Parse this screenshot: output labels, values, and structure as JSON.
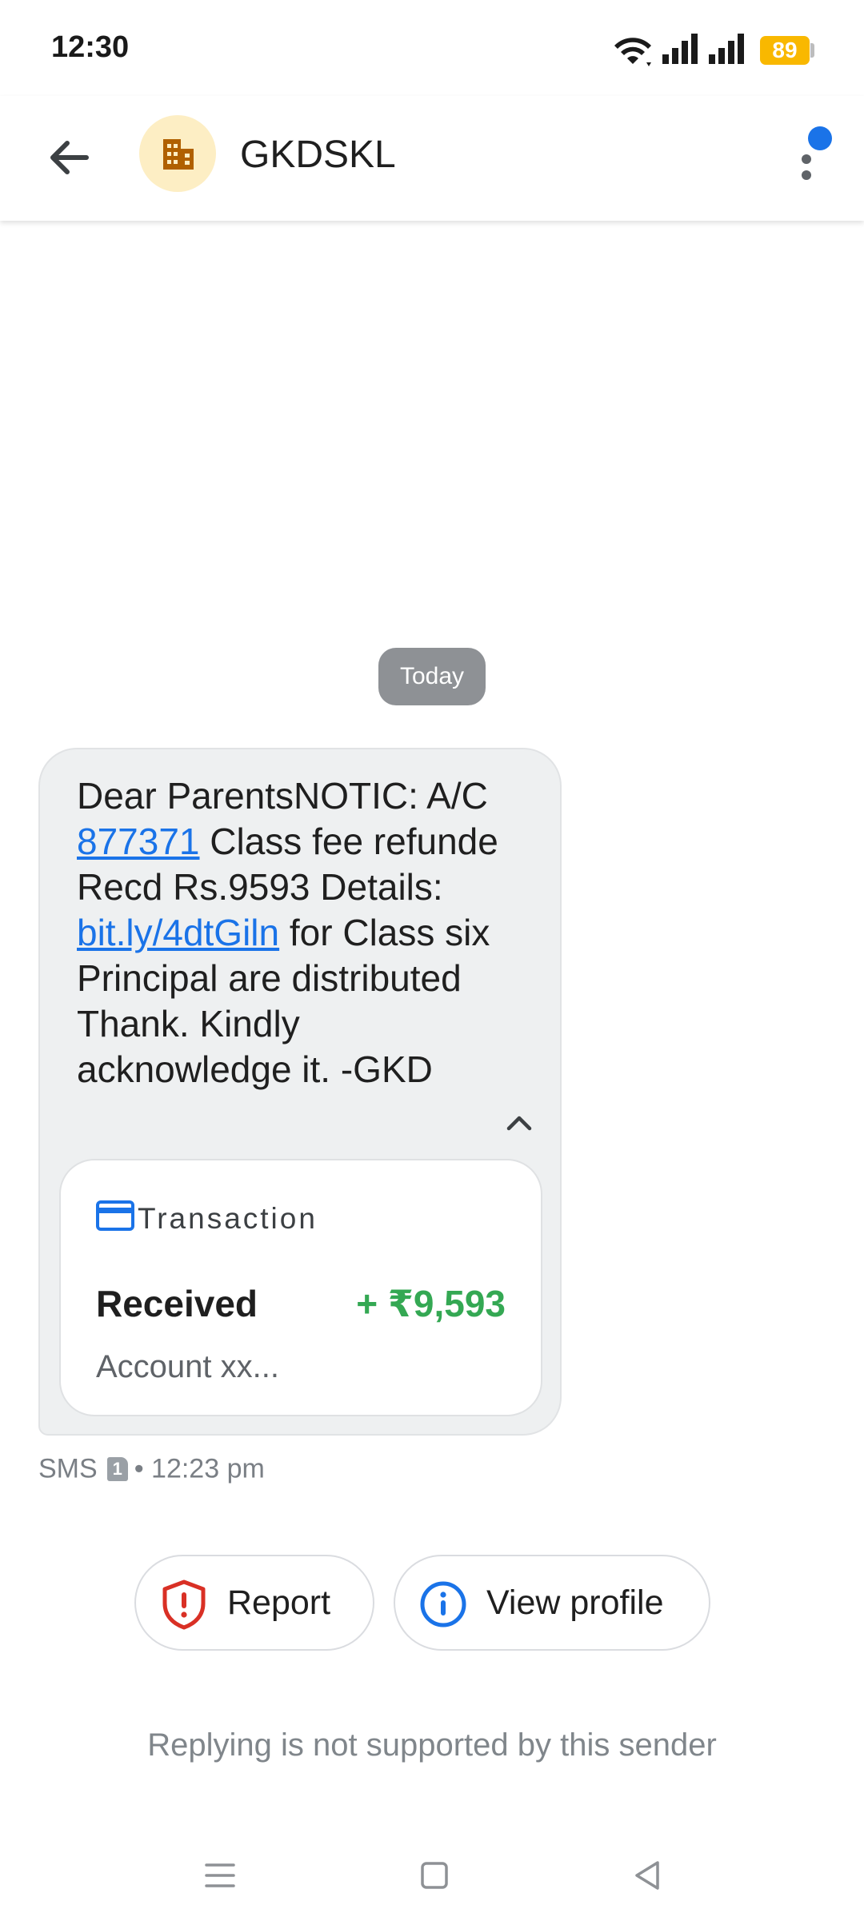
{
  "status_bar": {
    "time": "12:30",
    "battery": "89",
    "battery_color": "#f9b800"
  },
  "header": {
    "title": "GKDSKL",
    "avatar_icon": "business-icon",
    "avatar_bg": "#fdeec4",
    "has_notification_dot": true,
    "accent": "#1a73e8"
  },
  "conversation": {
    "date_label": "Today",
    "message": {
      "text_parts": [
        "Dear ParentsNOTIC: A/C ",
        "877371",
        " Class fee refunde Recd Rs.9593 Details: ",
        "bit.ly/4dtGiln",
        " for Class six Principal are distributed Thank. Kindly acknowledge it. -GKD"
      ],
      "links": [
        "877371",
        "bit.ly/4dtGiln"
      ]
    },
    "card": {
      "label": "Transaction",
      "status": "Received",
      "amount": "+ ₹9,593",
      "amount_color": "#34a853",
      "account": "Account xx..."
    },
    "meta": {
      "channel": "SMS",
      "sim": "1",
      "time": "• 12:23 pm"
    }
  },
  "actions": {
    "report_label": "Report",
    "view_profile_label": "View profile"
  },
  "footer": {
    "reply_note": "Replying is not supported by this sender"
  },
  "nav_bar": {
    "items": [
      "menu-icon",
      "home-icon",
      "back-icon"
    ]
  }
}
